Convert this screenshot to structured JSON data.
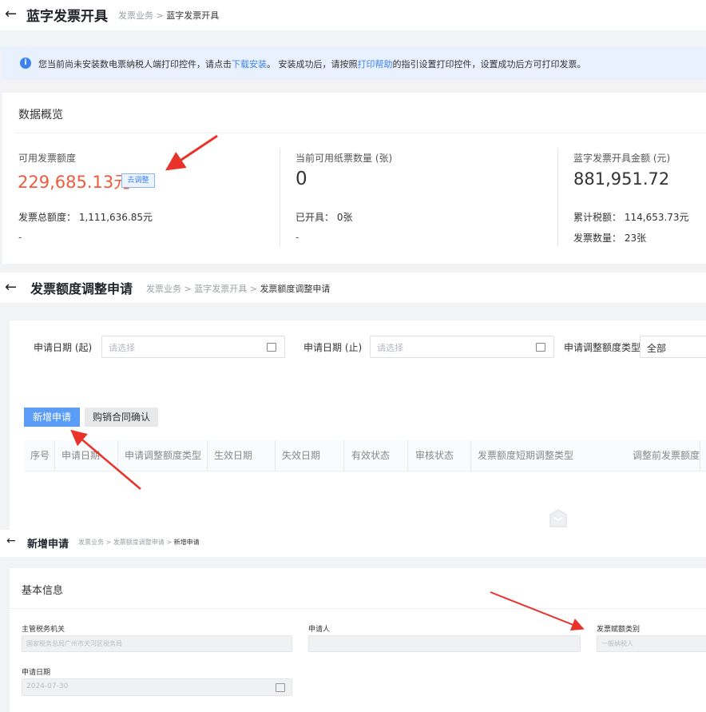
{
  "page1": {
    "title": "蓝字发票开具",
    "crumb1": "发票业务",
    "crumb2": "蓝字发票开具",
    "notice_before": "您当前尚未安装数电票纳税人端打印控件，请点击",
    "notice_link1": "下载安装",
    "notice_mid": "。 安装成功后，请按照",
    "notice_link2": "打印帮助",
    "notice_after": "的指引设置打印控件，设置成功后方可打印发票。",
    "overview_title": "数据概览",
    "stat1_label": "可用发票额度",
    "stat1_value": "229,685.13元",
    "stat1_tag": "去调整",
    "stat1_sub_label": "发票总额度：",
    "stat1_sub_value": "1,111,636.85元",
    "stat1_dash": "-",
    "stat2_label": "当前可用纸票数量 (张)",
    "stat2_value": "0",
    "stat2_sub_label": "已开具：",
    "stat2_sub_value": "0张",
    "stat2_dash": "-",
    "stat3_label": "蓝字发票开具金额 (元)",
    "stat3_value": "881,951.72",
    "stat3_sub_label": "累计税额：",
    "stat3_sub_value": "114,653.73元",
    "stat3_sub2_label": "发票数量：",
    "stat3_sub2_value": "23张"
  },
  "page2": {
    "title": "发票额度调整申请",
    "crumb1": "发票业务",
    "crumb2": "蓝字发票开具",
    "crumb3": "发票额度调整申请",
    "date_start_label": "申请日期 (起)",
    "date_start_ph": "请选择",
    "date_end_label": "申请日期 (止)",
    "date_end_ph": "请选择",
    "type_label": "申请调整额度类型",
    "type_value": "全部",
    "btn_new": "新增申请",
    "btn_contract": "购销合同确认",
    "columns": [
      "序号",
      "申请日期",
      "申请调整额度类型",
      "生效日期",
      "失效日期",
      "有效状态",
      "审核状态",
      "发票额度短期调整类型",
      "调整前发票额度"
    ]
  },
  "page3": {
    "title": "新增申请",
    "crumb1": "发票业务",
    "crumb2": "发票额度调整申请",
    "crumb3": "新增申请",
    "section_title": "基本信息",
    "field1_label": "主管税务机关",
    "field1_value": "国家税务总局广州市天河区税务局",
    "field2_label": "申请人",
    "field2_value": "",
    "field3_label": "发票赋额类别",
    "field3_value": "一般纳税人",
    "field4_label": "申请日期",
    "field4_value": "2024-07-30"
  },
  "colors": {
    "accent": "#3b82f6",
    "amount": "#f05a3c",
    "arrow": "#e8322a"
  }
}
